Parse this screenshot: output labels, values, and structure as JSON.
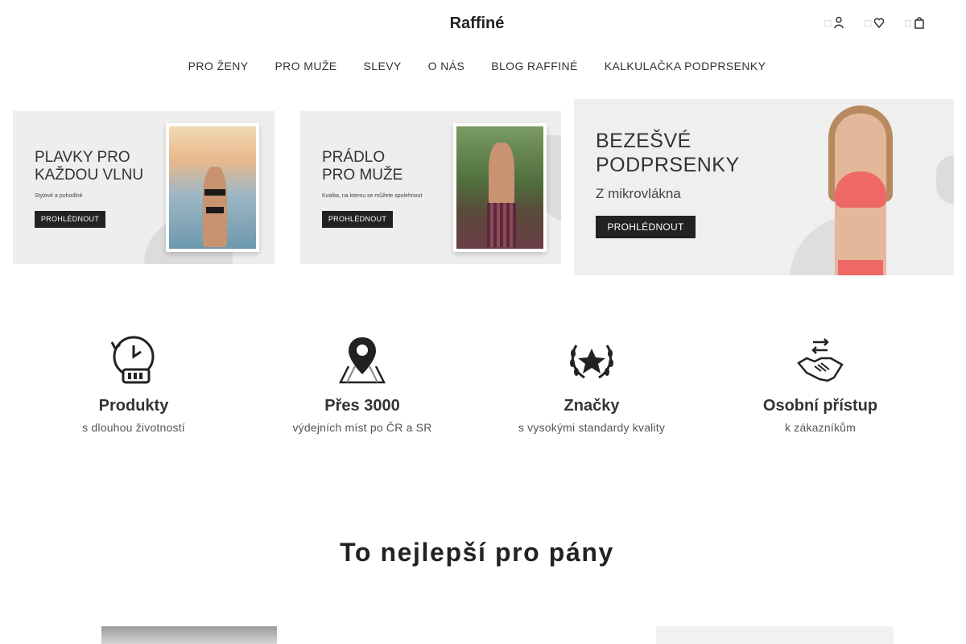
{
  "brand": "Raffiné",
  "header_icons": [
    "account-icon",
    "wishlist-icon",
    "cart-icon"
  ],
  "nav": [
    "PRO ŽENY",
    "PRO MUŽE",
    "SLEVY",
    "O NÁS",
    "BLOG RAFFINÉ",
    "KALKULAČKA PODPRSENKY"
  ],
  "banners": [
    {
      "title": "PLAVKY PRO\nKAŽDOU VLNU",
      "subtitle": "Stylové a pohodlné",
      "button": "PROHLÉDNOUT"
    },
    {
      "title": "PRÁDLO\nPRO MUŽE",
      "subtitle": "Kvalita, na kterou se můžete spolehnout",
      "button": "PROHLÉDNOUT"
    },
    {
      "title": "BEZEŠVÉ\nPODPRSENKY",
      "subtitle": "Z mikrovlákna",
      "button": "PROHLÉDNOUT"
    }
  ],
  "features": [
    {
      "icon": "durability-clock-icon",
      "title": "Produkty",
      "subtitle": "s dlouhou životností"
    },
    {
      "icon": "location-pin-icon",
      "title": "Přes 3000",
      "subtitle": "výdejních míst po ČR a SR"
    },
    {
      "icon": "laurel-star-icon",
      "title": "Značky",
      "subtitle": "s vysokými standardy kvality"
    },
    {
      "icon": "handshake-icon",
      "title": "Osobní přístup",
      "subtitle": "k zákazníkům"
    }
  ],
  "section_title": "To nejlepší pro pány",
  "colors": {
    "text": "#222222",
    "button": "#222222",
    "banner_bg": "#eeeeee"
  }
}
